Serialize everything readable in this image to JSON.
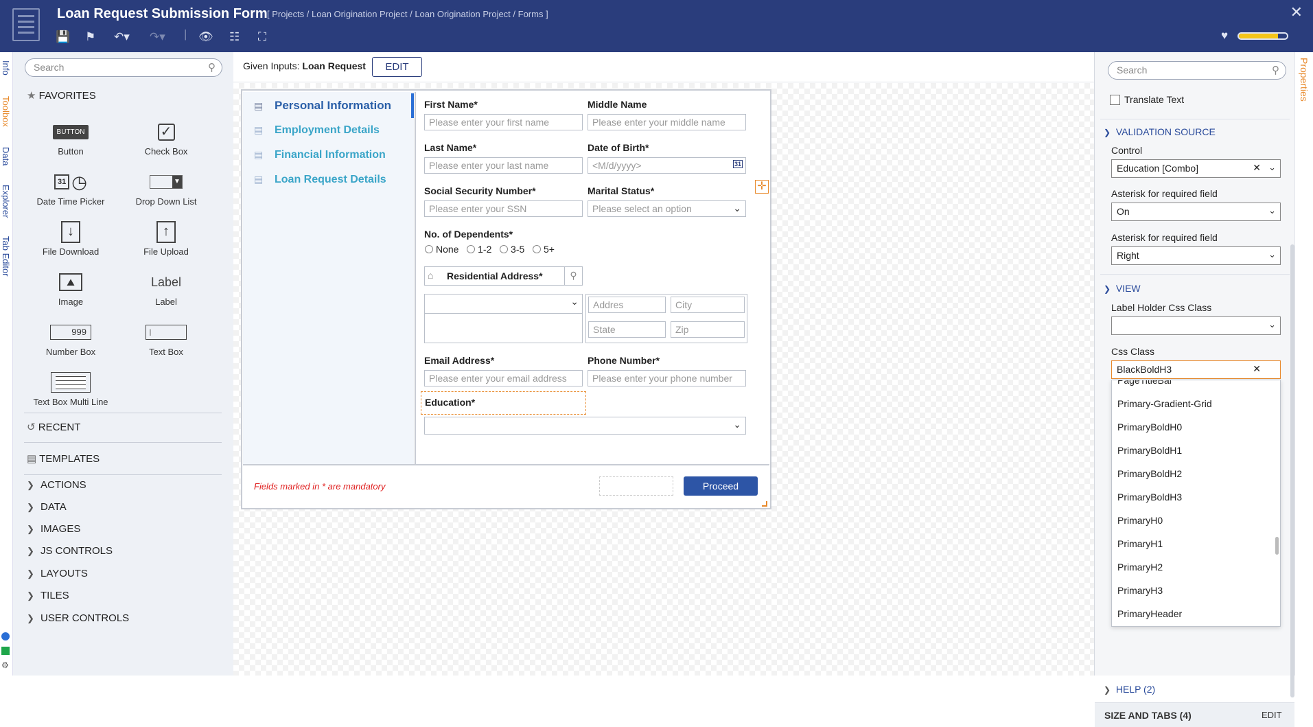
{
  "header": {
    "title": "Loan Request Submission Form",
    "breadcrumb": "[ Projects / Loan Origination Project / Loan Origination Project / Forms ]"
  },
  "sidetabs": [
    "Info",
    "Toolbox",
    "Data",
    "Explorer",
    "Tab Editor"
  ],
  "righttab": "Properties",
  "left": {
    "search_placeholder": "Search",
    "favorites": "FAVORITES",
    "tools": [
      {
        "label": "Button",
        "icon_text": "BUTTON"
      },
      {
        "label": "Check Box"
      },
      {
        "label": "Date Time Picker",
        "icon_text": "31"
      },
      {
        "label": "Drop Down List"
      },
      {
        "label": "File Download"
      },
      {
        "label": "File Upload"
      },
      {
        "label": "Image"
      },
      {
        "label": "Label",
        "icon_text": "Label"
      },
      {
        "label": "Number Box",
        "icon_text": "999"
      },
      {
        "label": "Text Box"
      },
      {
        "label": "Text Box Multi Line"
      }
    ],
    "recent": "RECENT",
    "templates": "TEMPLATES",
    "categories": [
      "ACTIONS",
      "DATA",
      "IMAGES",
      "JS CONTROLS",
      "LAYOUTS",
      "TILES",
      "USER CONTROLS"
    ]
  },
  "canvas": {
    "given_inputs_label": "Given Inputs:",
    "given_inputs_value": "Loan Request",
    "edit": "EDIT",
    "nav": [
      "Personal Information",
      "Employment Details",
      "Financial Information",
      "Loan Request Details"
    ],
    "fields": {
      "first_name": {
        "label": "First Name*",
        "placeholder": "Please enter your first name"
      },
      "middle_name": {
        "label": "Middle Name",
        "placeholder": "Please enter your middle name"
      },
      "last_name": {
        "label": "Last Name*",
        "placeholder": "Please enter your last name"
      },
      "dob": {
        "label": "Date of Birth*",
        "placeholder": "<M/d/yyyy>",
        "icon_text": "31"
      },
      "ssn": {
        "label": "Social Security Number*",
        "placeholder": "Please enter your SSN"
      },
      "marital": {
        "label": "Marital Status*",
        "placeholder": "Please select an option"
      },
      "dependents": {
        "label": "No. of Dependents*",
        "options": [
          "None",
          "1-2",
          "3-5",
          "5+"
        ]
      },
      "address": {
        "label": "Residential Address*",
        "addres": "Addres",
        "city": "City",
        "state": "State",
        "zip": "Zip"
      },
      "email": {
        "label": "Email Address*",
        "placeholder": "Please enter your email address"
      },
      "phone": {
        "label": "Phone Number*",
        "placeholder": "Please enter your phone number"
      },
      "education": {
        "label": "Education*"
      }
    },
    "mandatory_note": "Fields marked in * are mandatory",
    "proceed": "Proceed"
  },
  "right": {
    "search_placeholder": "Search",
    "translate": "Translate Text",
    "validation_source": "VALIDATION SOURCE",
    "control_label": "Control",
    "control_value": "Education [Combo]",
    "asterisk1_label": "Asterisk for required field",
    "asterisk1_value": "On",
    "asterisk2_label": "Asterisk for required field",
    "asterisk2_value": "Right",
    "view": "VIEW",
    "label_holder_css": "Label Holder Css Class",
    "css_class": "Css Class",
    "css_value": "BlackBoldH3",
    "dropdown_items": [
      "PageTitleBar",
      "Primary-Gradient-Grid",
      "PrimaryBoldH0",
      "PrimaryBoldH1",
      "PrimaryBoldH2",
      "PrimaryBoldH3",
      "PrimaryH0",
      "PrimaryH1",
      "PrimaryH2",
      "PrimaryH3",
      "PrimaryHeader"
    ],
    "help": "HELP (2)",
    "size_tabs": "SIZE AND TABS (4)",
    "size_edit": "EDIT"
  },
  "colors": {
    "header": "#2a3d7c",
    "nav": "#3aa5c8",
    "accent_orange": "#e8892b",
    "proceed": "#2d55a6"
  }
}
